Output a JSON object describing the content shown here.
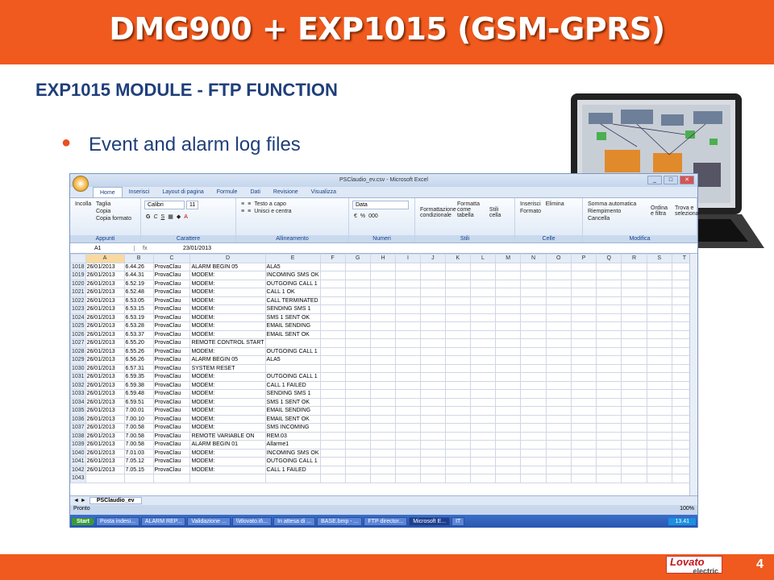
{
  "slide": {
    "title": "DMG900 + EXP1015 (GSM-GPRS)",
    "subtitle": "EXP1015 MODULE - FTP FUNCTION",
    "bullet": "Event and alarm log files",
    "page": "4",
    "logo": "Lovato",
    "logo_sub": "electric"
  },
  "colors": {
    "accent": "#f05a1e",
    "text": "#1f3f7a"
  },
  "excel": {
    "window_title": "PSClaudio_ev.csv - Microsoft Excel",
    "tabs": [
      "Home",
      "Inserisci",
      "Layout di pagina",
      "Formule",
      "Dati",
      "Revisione",
      "Visualizza"
    ],
    "ribbon": {
      "clipboard": {
        "paste": "Incolla",
        "cut": "Taglia",
        "copy": "Copia",
        "format": "Copia formato",
        "label": "Appunti"
      },
      "font": {
        "name": "Calibri",
        "size": "11",
        "label": "Carattere"
      },
      "align": {
        "wrap": "Testo a capo",
        "merge": "Unisci e centra",
        "label": "Allineamento"
      },
      "number": {
        "format": "Data",
        "label": "Numeri"
      },
      "styles": {
        "cond": "Formattazione condizionale",
        "table": "Formatta come tabella",
        "cell": "Stili cella",
        "label": "Stili"
      },
      "cells": {
        "insert": "Inserisci",
        "delete": "Elimina",
        "format": "Formato",
        "label": "Celle"
      },
      "edit": {
        "sum": "Somma automatica",
        "fill": "Riempimento",
        "clear": "Cancella",
        "sort": "Ordina e filtra",
        "find": "Trova e seleziona",
        "label": "Modifica"
      }
    },
    "name_box": "A1",
    "formula": "23/01/2013",
    "columns": [
      "A",
      "B",
      "C",
      "D",
      "E",
      "F",
      "G",
      "H",
      "I",
      "J",
      "K",
      "L",
      "M",
      "N",
      "O",
      "P",
      "Q",
      "R",
      "S",
      "T"
    ],
    "rows": [
      [
        "1018",
        "26/01/2013",
        "6.44.26",
        "ProvaClau",
        "ALARM BEGIN 05",
        "ALA5"
      ],
      [
        "1019",
        "26/01/2013",
        "6.44.31",
        "ProvaClau",
        "MODEM:",
        "INCOMING SMS OK"
      ],
      [
        "1020",
        "26/01/2013",
        "6.52.19",
        "ProvaClau",
        "MODEM:",
        "OUTGOING CALL 1"
      ],
      [
        "1021",
        "26/01/2013",
        "6.52.48",
        "ProvaClau",
        "MODEM:",
        "CALL 1 OK"
      ],
      [
        "1022",
        "26/01/2013",
        "6.53.05",
        "ProvaClau",
        "MODEM:",
        "CALL TERMINATED"
      ],
      [
        "1023",
        "26/01/2013",
        "6.53.15",
        "ProvaClau",
        "MODEM:",
        "SENDING SMS 1"
      ],
      [
        "1024",
        "26/01/2013",
        "6.53.19",
        "ProvaClau",
        "MODEM:",
        "SMS 1 SENT OK"
      ],
      [
        "1025",
        "26/01/2013",
        "6.53.28",
        "ProvaClau",
        "MODEM:",
        "EMAIL SENDING"
      ],
      [
        "1026",
        "26/01/2013",
        "6.53.37",
        "ProvaClau",
        "MODEM:",
        "EMAIL SENT OK"
      ],
      [
        "1027",
        "26/01/2013",
        "6.55.20",
        "ProvaClau",
        "REMOTE CONTROL START",
        ""
      ],
      [
        "1028",
        "26/01/2013",
        "6.55.26",
        "ProvaClau",
        "MODEM:",
        "OUTGOING CALL 1"
      ],
      [
        "1029",
        "26/01/2013",
        "6.56.26",
        "ProvaClau",
        "ALARM BEGIN 05",
        "ALA5"
      ],
      [
        "1030",
        "26/01/2013",
        "6.57.31",
        "ProvaClau",
        "SYSTEM RESET",
        ""
      ],
      [
        "1031",
        "26/01/2013",
        "6.59.35",
        "ProvaClau",
        "MODEM:",
        "OUTGOING CALL 1"
      ],
      [
        "1032",
        "26/01/2013",
        "6.59.38",
        "ProvaClau",
        "MODEM:",
        "CALL 1 FAILED"
      ],
      [
        "1033",
        "26/01/2013",
        "6.59.48",
        "ProvaClau",
        "MODEM:",
        "SENDING SMS 1"
      ],
      [
        "1034",
        "26/01/2013",
        "6.59.51",
        "ProvaClau",
        "MODEM:",
        "SMS 1 SENT OK"
      ],
      [
        "1035",
        "26/01/2013",
        "7.00.01",
        "ProvaClau",
        "MODEM:",
        "EMAIL SENDING"
      ],
      [
        "1036",
        "26/01/2013",
        "7.00.10",
        "ProvaClau",
        "MODEM:",
        "EMAIL SENT OK"
      ],
      [
        "1037",
        "26/01/2013",
        "7.00.58",
        "ProvaClau",
        "MODEM:",
        "SMS INCOMING"
      ],
      [
        "1038",
        "26/01/2013",
        "7.00.58",
        "ProvaClau",
        "REMOTE VARIABLE ON",
        "REM.03"
      ],
      [
        "1039",
        "26/01/2013",
        "7.00.58",
        "ProvaClau",
        "ALARM BEGIN 01",
        "Allarme1"
      ],
      [
        "1040",
        "26/01/2013",
        "7.01.03",
        "ProvaClau",
        "MODEM:",
        "INCOMING SMS OK"
      ],
      [
        "1041",
        "26/01/2013",
        "7.05.12",
        "ProvaClau",
        "MODEM:",
        "OUTGOING CALL 1"
      ],
      [
        "1042",
        "26/01/2013",
        "7.05.15",
        "ProvaClau",
        "MODEM:",
        "CALL 1 FAILED"
      ],
      [
        "1043",
        "",
        "",
        "",
        "",
        ""
      ]
    ],
    "sheet_tab": "PSClaudio_ev",
    "status": "Pronto",
    "zoom": "100%",
    "taskbar": {
      "start": "Start",
      "items": [
        "Posta indesi...",
        "ALARM REP...",
        "Validazione ...",
        "\\\\itlovato.it\\...",
        "In attesa di ...",
        "BASE.bmp - ...",
        "FTP director...",
        "Microsoft E..."
      ],
      "clock": "13.41",
      "lang": "IT"
    }
  }
}
